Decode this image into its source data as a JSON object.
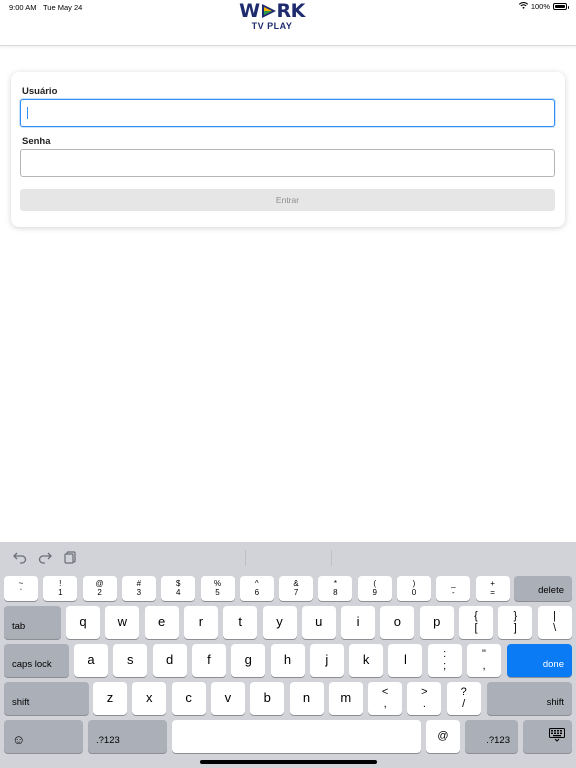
{
  "status_bar": {
    "time": "9:00 AM",
    "date": "Tue May 24",
    "battery": "100%",
    "battery_level": 1.0
  },
  "app": {
    "logo_top": "WORK",
    "logo_bottom": "TV PLAY",
    "brand_color": "#1e2b6e"
  },
  "login_form": {
    "username_label": "Usuário",
    "username_value": "",
    "password_label": "Senha",
    "password_value": "",
    "submit_label": "Entrar",
    "focus_color": "#2f8ff1"
  },
  "keyboard": {
    "toolbar_icons": [
      "undo-icon",
      "redo-icon",
      "paste-icon"
    ],
    "number_row": [
      {
        "top": "~",
        "bot": "`"
      },
      {
        "top": "!",
        "bot": "1"
      },
      {
        "top": "@",
        "bot": "2"
      },
      {
        "top": "#",
        "bot": "3"
      },
      {
        "top": "$",
        "bot": "4"
      },
      {
        "top": "%",
        "bot": "5"
      },
      {
        "top": "^",
        "bot": "6"
      },
      {
        "top": "&",
        "bot": "7"
      },
      {
        "top": "*",
        "bot": "8"
      },
      {
        "top": "(",
        "bot": "9"
      },
      {
        "top": ")",
        "bot": "0"
      },
      {
        "top": "_",
        "bot": "-"
      },
      {
        "top": "+",
        "bot": "="
      }
    ],
    "delete_label": "delete",
    "tab_label": "tab",
    "row1_letters": [
      "q",
      "w",
      "e",
      "r",
      "t",
      "y",
      "u",
      "i",
      "o",
      "p"
    ],
    "row1_extra": [
      {
        "top": "{",
        "bot": "["
      },
      {
        "top": "}",
        "bot": "]"
      },
      {
        "top": "|",
        "bot": "\\"
      }
    ],
    "caps_label": "caps lock",
    "row2_letters": [
      "a",
      "s",
      "d",
      "f",
      "g",
      "h",
      "j",
      "k",
      "l"
    ],
    "row2_extra": [
      {
        "top": ":",
        "bot": ";"
      },
      {
        "top": "\"",
        "bot": ","
      }
    ],
    "done_label": "done",
    "shift_label": "shift",
    "row3_letters": [
      "z",
      "x",
      "c",
      "v",
      "b",
      "n",
      "m"
    ],
    "row3_extra": [
      {
        "top": "<",
        "bot": ","
      },
      {
        "top": ">",
        "bot": "."
      },
      {
        "top": "?",
        "bot": "/"
      }
    ],
    "emoji_glyph": "☺",
    "numbers_label": ".?123",
    "at_label": "@",
    "done_color": "#0a7bf5"
  }
}
